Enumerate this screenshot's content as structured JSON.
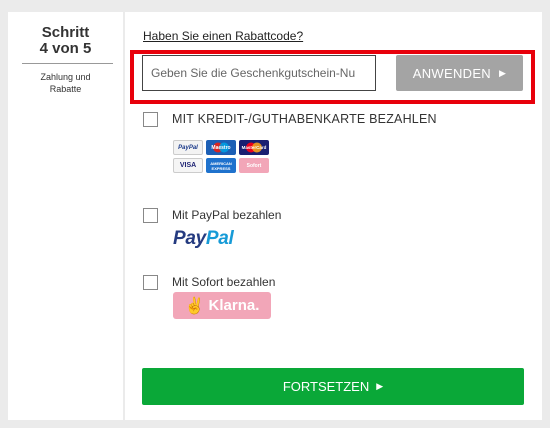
{
  "sidebar": {
    "step_title": "Schritt",
    "step_count": "4 von 5",
    "step_subtitle": "Zahlung und Rabatte"
  },
  "voucher": {
    "link_label": "Haben Sie einen Rabattcode?",
    "input_placeholder": "Geben Sie die Geschenkgutschein-Nu",
    "input_value": "",
    "apply_label": "ANWENDEN",
    "apply_icon": "play-triangle-icon",
    "highlight_color": "#e8000b"
  },
  "payment_options": [
    {
      "label": "MIT KREDIT-/GUTHABENKARTE BEZAHLEN",
      "checked": false,
      "logos": [
        {
          "name": "PayPal"
        },
        {
          "name": "Maestro"
        },
        {
          "name": "MasterCard"
        },
        {
          "name": "VISA"
        },
        {
          "name": "AMERICAN EXPRESS"
        },
        {
          "name": "Sofort"
        }
      ]
    },
    {
      "label": "Mit PayPal bezahlen",
      "checked": false,
      "logo_text_part1": "Pay",
      "logo_text_part2": "Pal"
    },
    {
      "label": "Mit Sofort bezahlen",
      "checked": false,
      "logo_text": "Klarna."
    }
  ],
  "continue": {
    "label": "FORTSETZEN",
    "icon": "play-triangle-icon",
    "color": "#0aa838"
  }
}
